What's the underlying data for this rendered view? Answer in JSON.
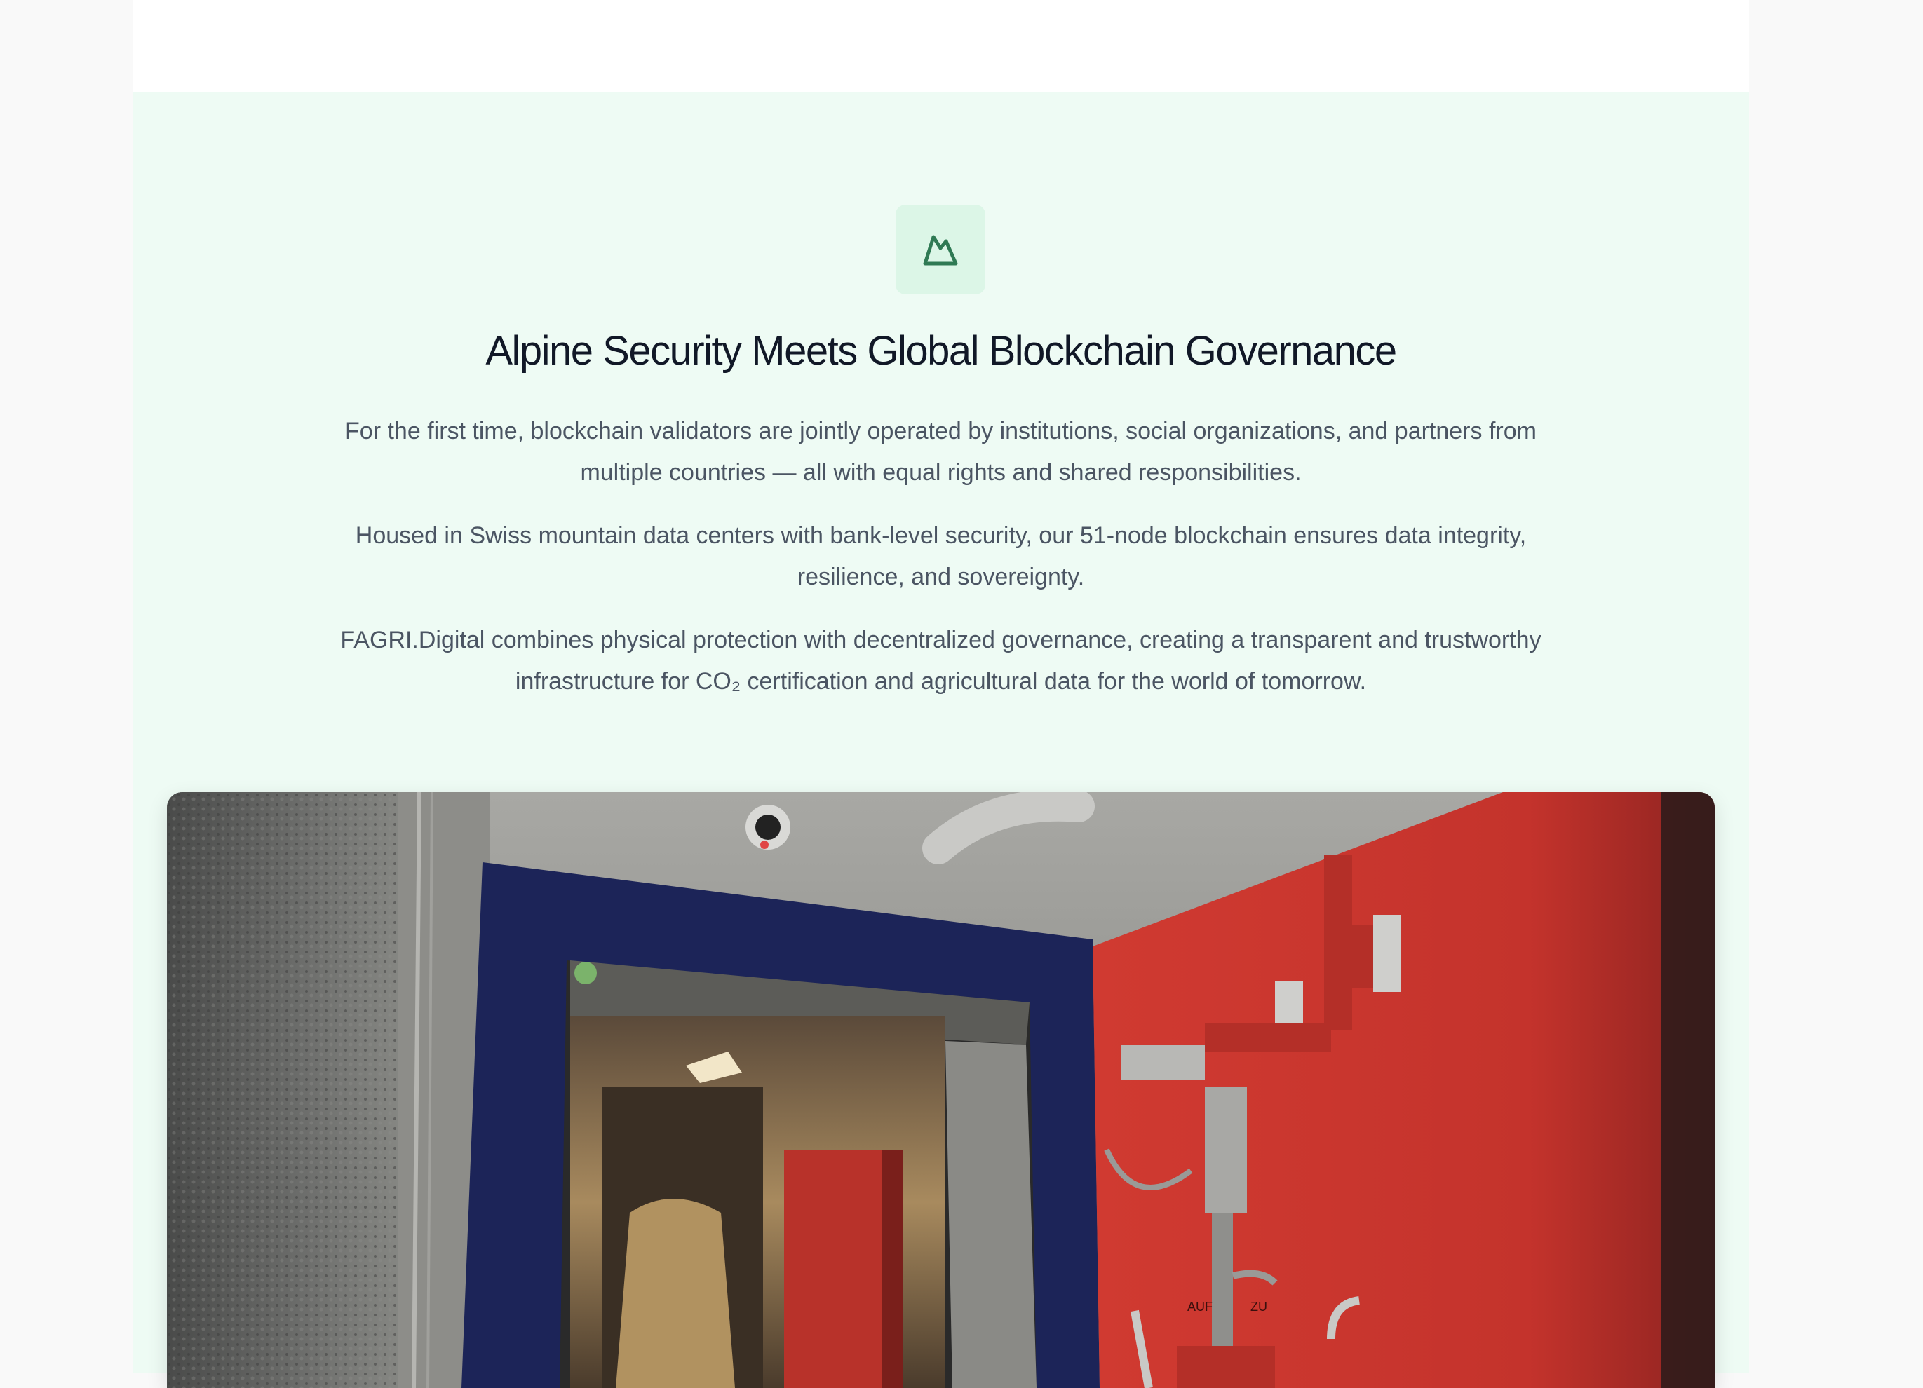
{
  "hero": {
    "icon": "mountain-icon",
    "title": "Alpine Security Meets Global Blockchain Governance",
    "paragraphs": [
      "For the first time, blockchain validators are jointly operated by institutions, social organizations, and partners from multiple countries — all with equal rights and shared responsibilities.",
      "Housed in Swiss mountain data centers with bank-level security, our 51-node blockchain ensures data integrity, resilience, and sovereignty.",
      "FAGRI.Digital combines physical protection with decentralized governance, creating a transparent and trustworthy infrastructure for CO₂ certification and agricultural data for the world of tomorrow."
    ]
  },
  "photo": {
    "door_labels": [
      "AUF",
      "ZU"
    ]
  },
  "colors": {
    "section_bg": "#eefbf4",
    "icon_tile_bg": "#dcf6e7",
    "icon_stroke": "#2f7a54",
    "title": "#111827",
    "body_text": "#4b5563",
    "vault_door_red": "#c8362f",
    "door_frame_navy": "#1c2458"
  }
}
